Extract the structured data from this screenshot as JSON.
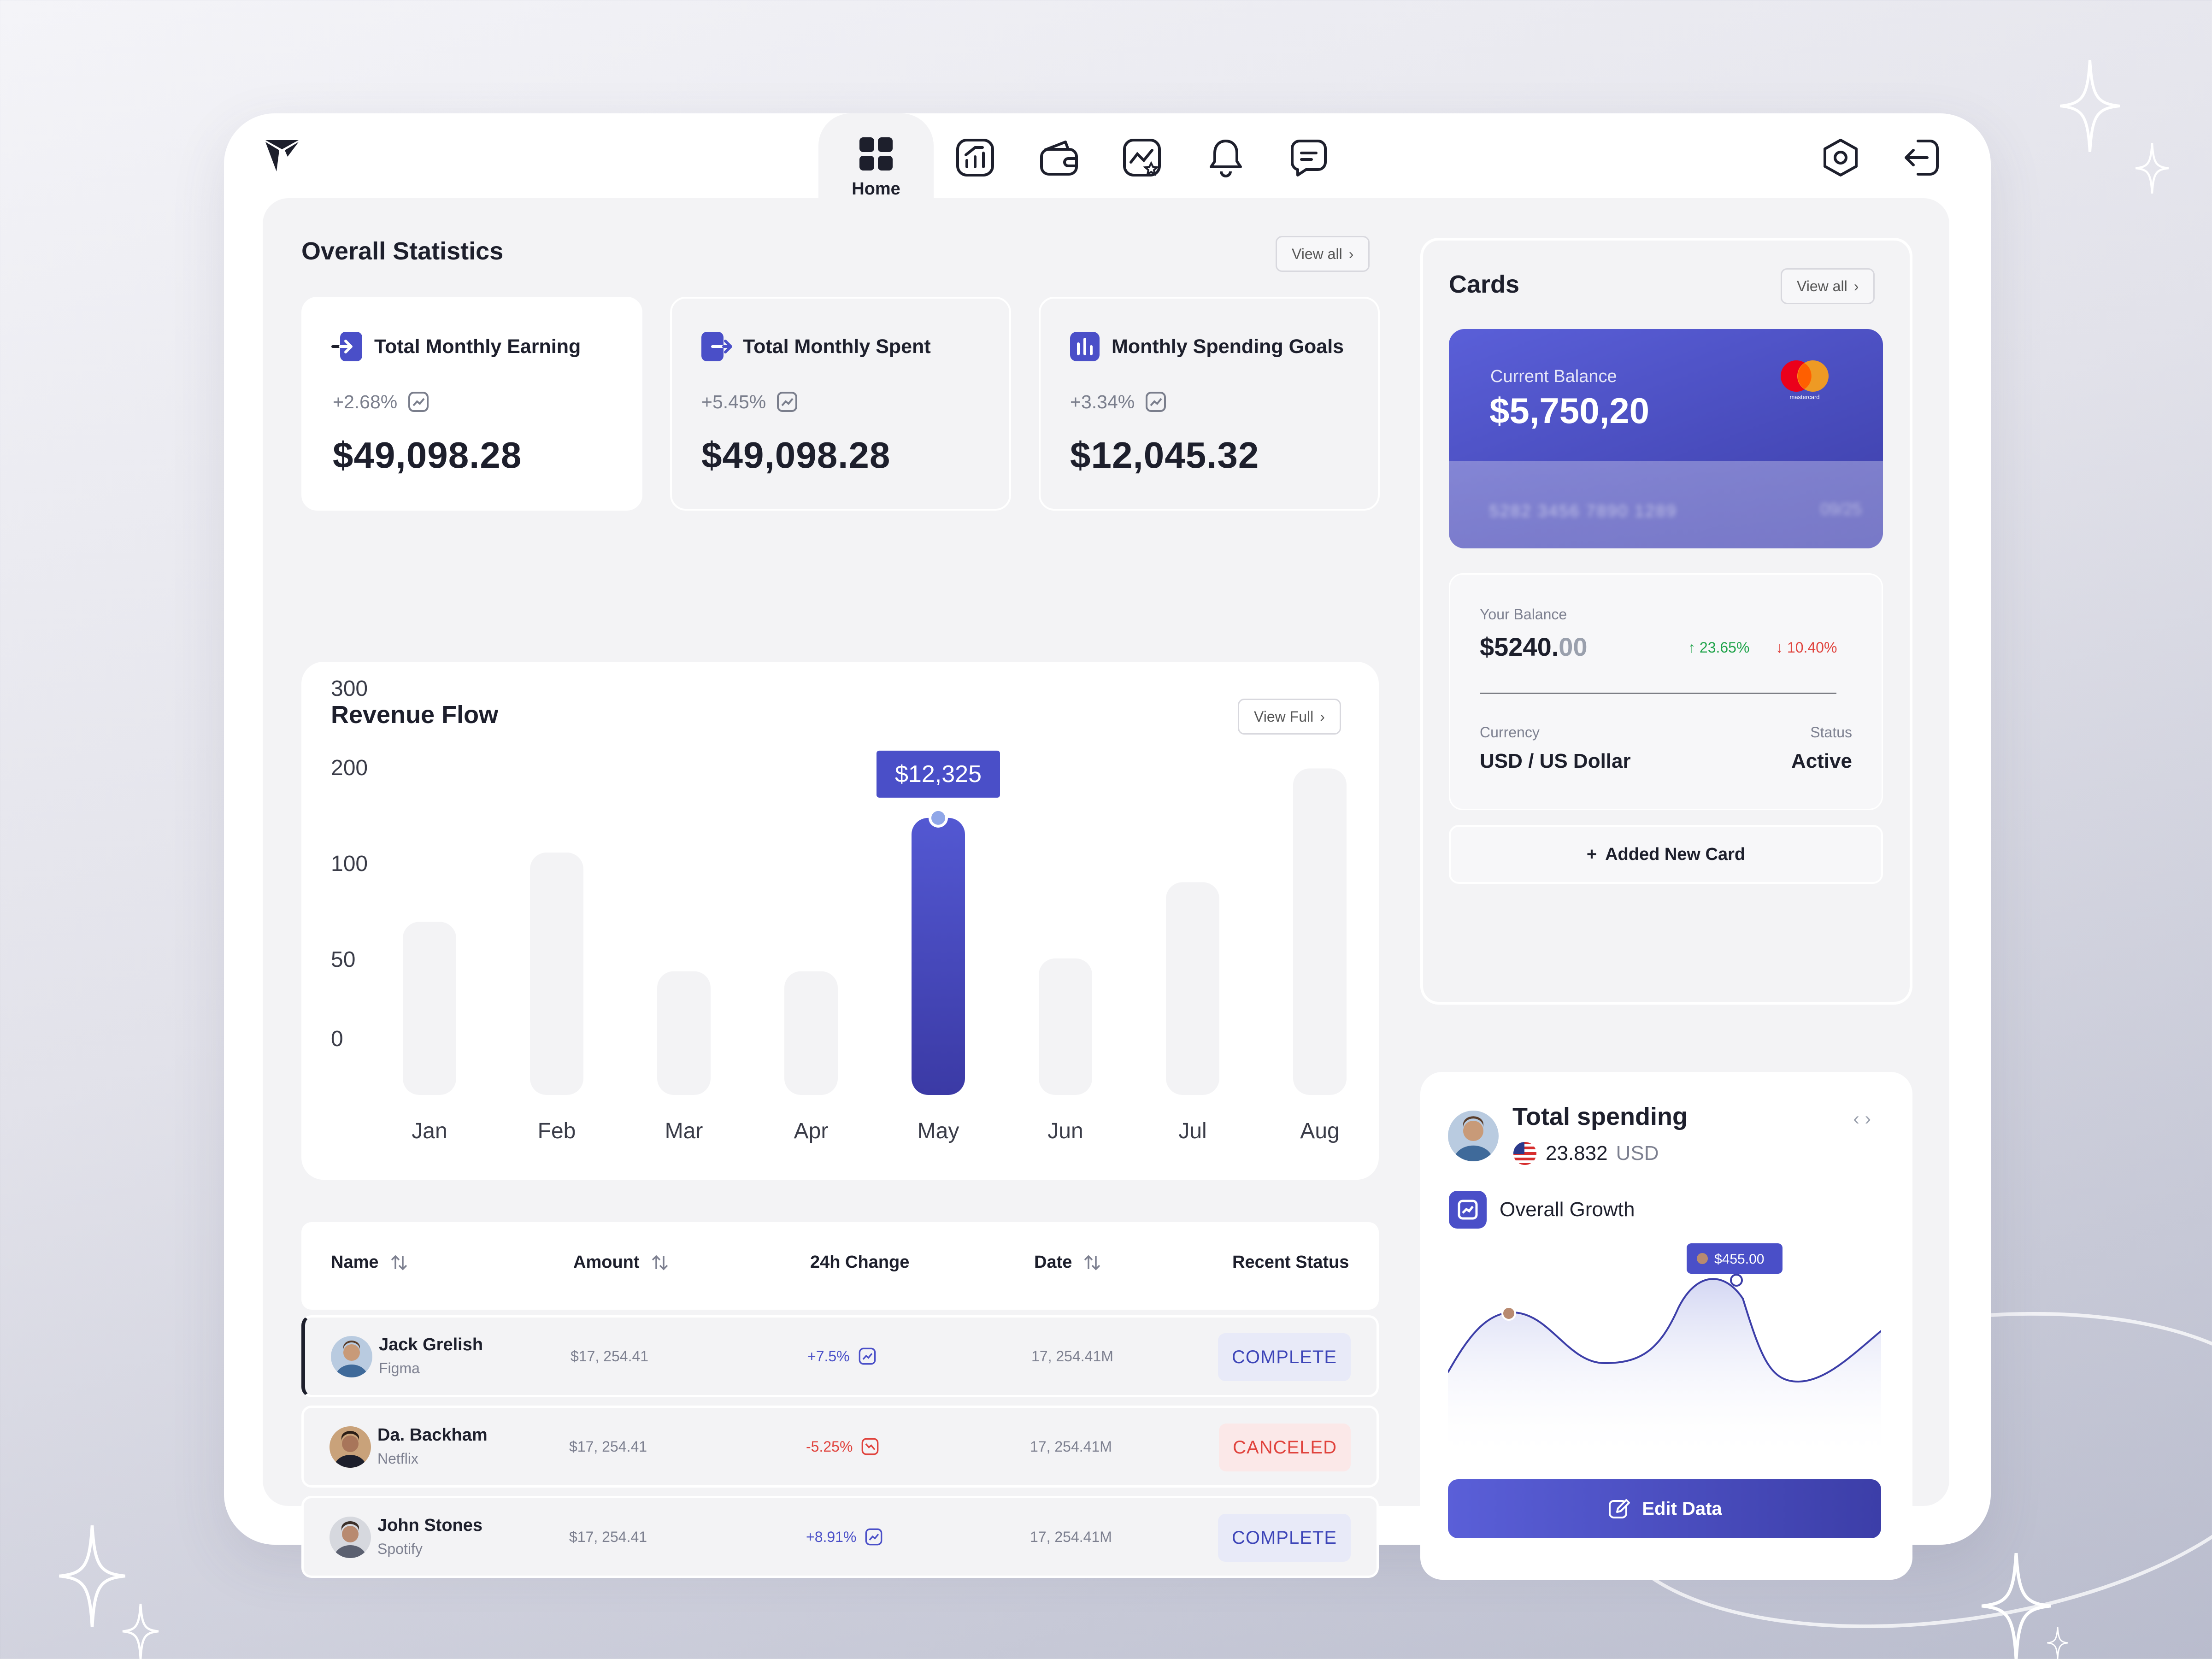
{
  "nav": {
    "home_label": "Home",
    "items": [
      "home-icon",
      "analytics-icon",
      "wallet-icon",
      "chart-star-icon",
      "bell-icon",
      "message-icon"
    ],
    "right_items": [
      "settings-icon",
      "logout-icon"
    ]
  },
  "overall": {
    "title": "Overall Statistics",
    "view_all": "View all",
    "cards": [
      {
        "title": "Total Monthly Earning",
        "change": "+2.68%",
        "value": "$49,098.28",
        "icon": "arrow-in-icon"
      },
      {
        "title": "Total Monthly Spent",
        "change": "+5.45%",
        "value": "$49,098.28",
        "icon": "arrow-out-icon"
      },
      {
        "title": "Monthly Spending Goals",
        "change": "+3.34%",
        "value": "$12,045.32",
        "icon": "bar-chart-icon"
      }
    ]
  },
  "revenue": {
    "title": "Revenue Flow",
    "view_full": "View Full",
    "tooltip": "$12,325"
  },
  "chart_data": {
    "type": "bar",
    "title": "Revenue Flow",
    "categories": [
      "Jan",
      "Feb",
      "Mar",
      "Apr",
      "May",
      "Jun",
      "Jul",
      "Aug"
    ],
    "values": [
      175,
      245,
      125,
      125,
      280,
      138,
      215,
      330
    ],
    "yticks": [
      "300",
      "200",
      "100",
      "50",
      "0"
    ],
    "highlight_index": 4,
    "highlight_label": "$12,325",
    "colors": {
      "bar": "#f3f3f5",
      "highlight_top": "#5358d2",
      "highlight_bottom": "#3b3aa5"
    }
  },
  "table": {
    "headers": [
      "Name",
      "Amount",
      "24h Change",
      "Date",
      "Recent Status"
    ],
    "rows": [
      {
        "name": "Jack Grelish",
        "company": "Figma",
        "amount": "$17, 254.41",
        "change": "+7.5%",
        "date": "17, 254.41M",
        "status": "COMPLETE",
        "trend": "up"
      },
      {
        "name": "Da. Backham",
        "company": "Netflix",
        "amount": "$17, 254.41",
        "change": "-5.25%",
        "date": "17, 254.41M",
        "status": "CANCELED",
        "trend": "down"
      },
      {
        "name": "John Stones",
        "company": "Spotify",
        "amount": "$17, 254.41",
        "change": "+8.91%",
        "date": "17, 254.41M",
        "status": "COMPLETE",
        "trend": "up"
      }
    ]
  },
  "cards": {
    "title": "Cards",
    "view_all": "View all",
    "current_balance_label": "Current Balance",
    "current_balance": "$5,750,20",
    "card_number": "5282 3456 7890 1289",
    "card_expiry": "09/25",
    "brand": "mastercard",
    "your_balance_label": "Your Balance",
    "your_balance_int": "$5240.",
    "your_balance_dec": "00",
    "up_change": "↑ 23.65%",
    "down_change": "↓ 10.40%",
    "currency_label": "Currency",
    "currency_value": "USD / US Dollar",
    "status_label": "Status",
    "status_value": "Active",
    "add_card": "Added New Card"
  },
  "spending": {
    "title": "Total spending",
    "amount": "23.832",
    "currency": "USD",
    "growth_label": "Overall Growth",
    "tooltip": "$455.00",
    "edit_button": "Edit Data"
  },
  "colors": {
    "accent": "#4a4fc8",
    "success": "#1fa34a",
    "danger": "#e0433d",
    "panel": "#f3f3f5"
  }
}
